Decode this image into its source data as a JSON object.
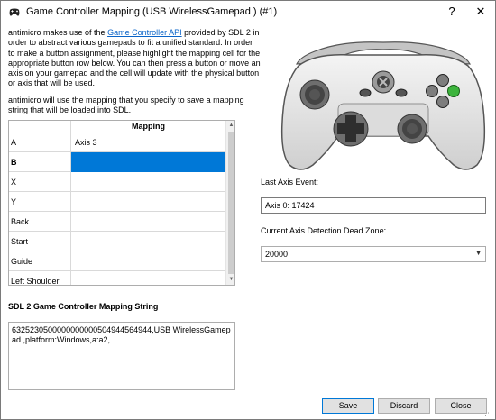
{
  "window": {
    "title": "Game Controller Mapping (USB WirelessGamepad ) (#1)",
    "help_label": "?",
    "close_label": "✕"
  },
  "intro": {
    "p1_before": "antimicro makes use of the ",
    "p1_link": "Game Controller API",
    "p1_after": " provided by SDL 2 in order to abstract various gamepads to fit a unified standard. In order to make a button assignment, please highlight the mapping cell for the appropriate button row below. You can then press a button or move an axis on your gamepad and the cell will update with the physical button or axis that will be used.",
    "p2": "antimicro will use the mapping that you specify to save a mapping string that will be loaded into SDL."
  },
  "table": {
    "column_header": "Mapping",
    "rows": [
      {
        "label": "A",
        "value": "Axis 3"
      },
      {
        "label": "B",
        "value": ""
      },
      {
        "label": "X",
        "value": ""
      },
      {
        "label": "Y",
        "value": ""
      },
      {
        "label": "Back",
        "value": ""
      },
      {
        "label": "Start",
        "value": ""
      },
      {
        "label": "Guide",
        "value": ""
      },
      {
        "label": "Left Shoulder",
        "value": ""
      }
    ],
    "selected_row": "B",
    "scroll_up": "▲",
    "scroll_down": "▼"
  },
  "last_axis": {
    "label": "Last Axis Event:",
    "value": "Axis 0: 17424"
  },
  "deadzone": {
    "label": "Current Axis Detection Dead Zone:",
    "value": "20000",
    "arrow": "▼"
  },
  "mapping_string": {
    "title": "SDL 2 Game Controller Mapping String",
    "value": "632523050000000000050494456494​4,USB WirelessGamepad ,platform:Windows,a:a2,"
  },
  "buttons": {
    "save": "Save",
    "discard": "Discard",
    "close": "Close"
  },
  "colors": {
    "selection": "#0078d7",
    "link": "#0a64c8",
    "green_button": "#3cb43c"
  },
  "icons": {
    "app": "gamepad-app-icon",
    "controller": "gamepad-image"
  }
}
